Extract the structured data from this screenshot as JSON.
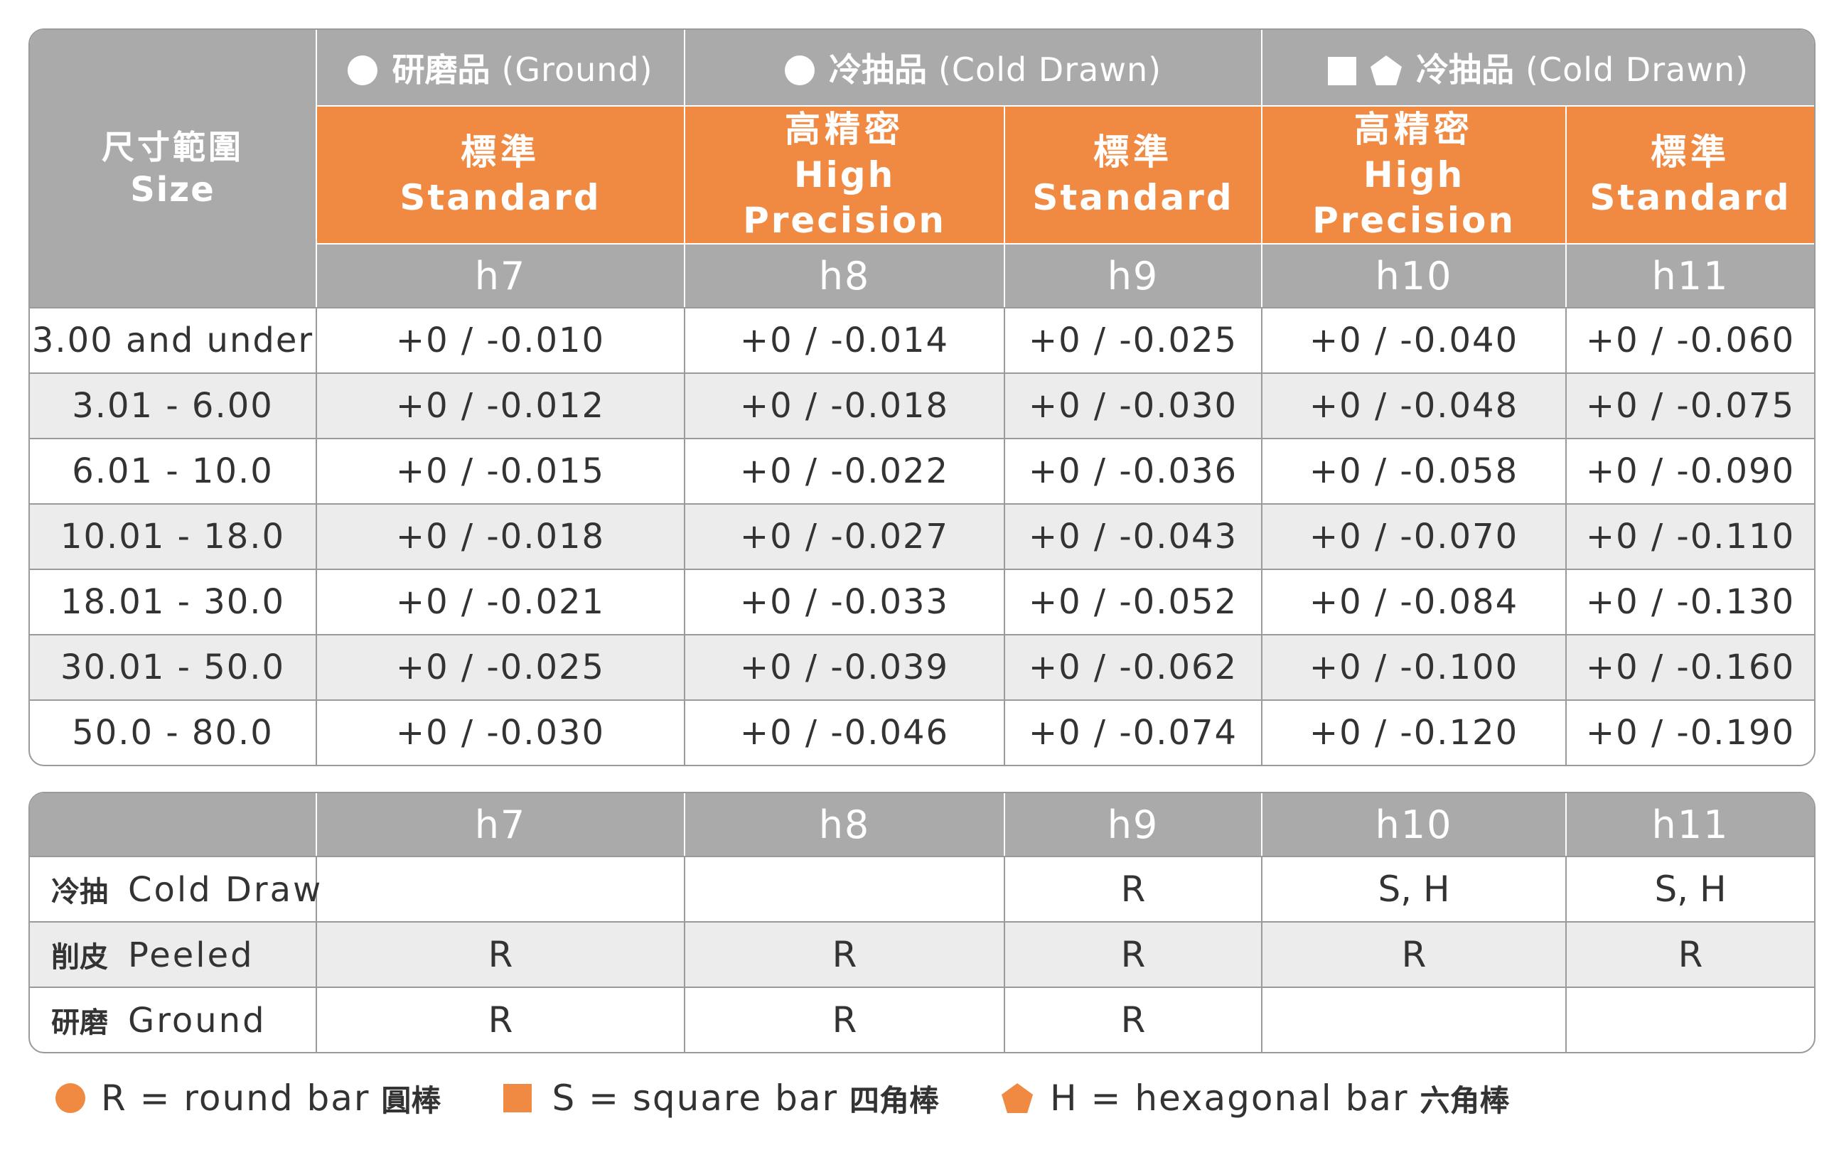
{
  "tolerance_table": {
    "size_header": {
      "zh": "尺寸範圍",
      "en": "Size"
    },
    "groups": [
      {
        "shape": "circle",
        "zh": "研磨品",
        "en": "(Ground)"
      },
      {
        "shape": "circle",
        "zh": "冷抽品",
        "en": "(Cold Drawn)"
      },
      {
        "shape": "square-hexagon",
        "zh": "冷抽品",
        "en": "(Cold Drawn)"
      }
    ],
    "grades": [
      {
        "zh": "標準",
        "en": "Standard"
      },
      {
        "zh": "高精密",
        "en": "High Precision"
      },
      {
        "zh": "標準",
        "en": "Standard"
      },
      {
        "zh": "高精密",
        "en": "High Precision"
      },
      {
        "zh": "標準",
        "en": "Standard"
      }
    ],
    "classes": [
      "h7",
      "h8",
      "h9",
      "h10",
      "h11"
    ],
    "rows": [
      {
        "size": "3.00 and under",
        "values": [
          "+0 / -0.010",
          "+0 / -0.014",
          "+0 / -0.025",
          "+0 / -0.040",
          "+0 / -0.060"
        ]
      },
      {
        "size": "3.01 - 6.00",
        "values": [
          "+0 / -0.012",
          "+0 / -0.018",
          "+0 / -0.030",
          "+0 / -0.048",
          "+0 / -0.075"
        ]
      },
      {
        "size": "6.01 - 10.0",
        "values": [
          "+0 / -0.015",
          "+0 / -0.022",
          "+0 / -0.036",
          "+0 / -0.058",
          "+0 / -0.090"
        ]
      },
      {
        "size": "10.01 - 18.0",
        "values": [
          "+0 / -0.018",
          "+0 / -0.027",
          "+0 / -0.043",
          "+0 / -0.070",
          "+0 / -0.110"
        ]
      },
      {
        "size": "18.01 - 30.0",
        "values": [
          "+0 / -0.021",
          "+0 / -0.033",
          "+0 / -0.052",
          "+0 / -0.084",
          "+0 / -0.130"
        ]
      },
      {
        "size": "30.01 - 50.0",
        "values": [
          "+0 / -0.025",
          "+0 / -0.039",
          "+0 / -0.062",
          "+0 / -0.100",
          "+0 / -0.160"
        ]
      },
      {
        "size": "50.0 - 80.0",
        "values": [
          "+0 / -0.030",
          "+0 / -0.046",
          "+0 / -0.074",
          "+0 / -0.120",
          "+0 / -0.190"
        ]
      }
    ]
  },
  "method_table": {
    "classes": [
      "h7",
      "h8",
      "h9",
      "h10",
      "h11"
    ],
    "rows": [
      {
        "zh": "冷抽",
        "en": "Cold Draw",
        "values": [
          "",
          "",
          "R",
          "S, H",
          "S, H"
        ]
      },
      {
        "zh": "削皮",
        "en": "Peeled",
        "values": [
          "R",
          "R",
          "R",
          "R",
          "R"
        ]
      },
      {
        "zh": "研磨",
        "en": "Ground",
        "values": [
          "R",
          "R",
          "R",
          "",
          ""
        ]
      }
    ]
  },
  "legend": [
    {
      "shape": "circle-icon",
      "en": "R = round bar",
      "zh": "圓棒"
    },
    {
      "shape": "square-icon",
      "en": "S = square bar",
      "zh": "四角棒"
    },
    {
      "shape": "pentagon-icon",
      "en": "H = hexagonal bar",
      "zh": "六角棒"
    }
  ],
  "colors": {
    "accent": "#f08a42",
    "header_gray": "#aaaaaa",
    "row_alt": "#ececec",
    "border": "#9a9a9a"
  }
}
